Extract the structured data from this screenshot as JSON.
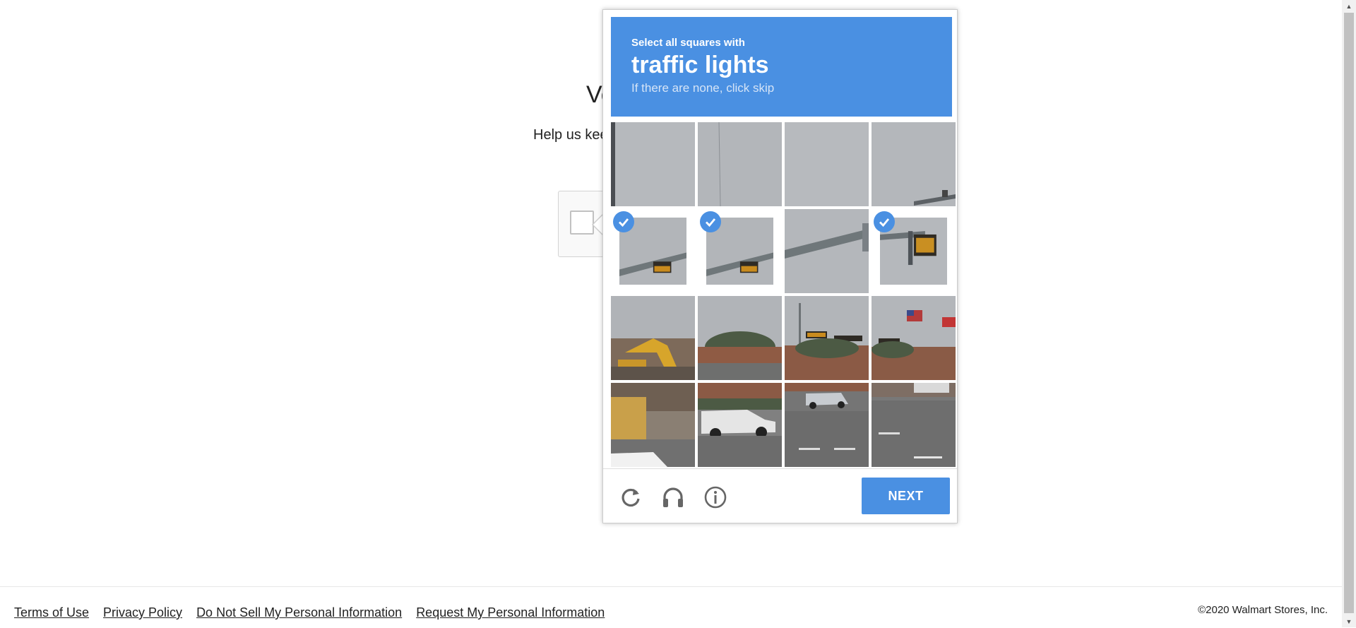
{
  "page": {
    "title_fragment": "Ve",
    "subtitle_fragment": "Help us kee"
  },
  "captcha": {
    "header_line1": "Select all squares with",
    "header_target": "traffic lights",
    "header_hint": "If there are none, click skip",
    "next_label": "NEXT",
    "accent_color": "#4a90e2",
    "tiles": [
      {
        "row": 0,
        "col": 0,
        "selected": false,
        "scene": "sky-pole-left"
      },
      {
        "row": 0,
        "col": 1,
        "selected": false,
        "scene": "sky-wire"
      },
      {
        "row": 0,
        "col": 2,
        "selected": false,
        "scene": "sky"
      },
      {
        "row": 0,
        "col": 3,
        "selected": false,
        "scene": "sky-arm"
      },
      {
        "row": 1,
        "col": 0,
        "selected": true,
        "scene": "arm-light"
      },
      {
        "row": 1,
        "col": 1,
        "selected": true,
        "scene": "arm-light"
      },
      {
        "row": 1,
        "col": 2,
        "selected": false,
        "scene": "arm"
      },
      {
        "row": 1,
        "col": 3,
        "selected": true,
        "scene": "light-box"
      },
      {
        "row": 2,
        "col": 0,
        "selected": false,
        "scene": "excavator"
      },
      {
        "row": 2,
        "col": 1,
        "selected": false,
        "scene": "trees-building"
      },
      {
        "row": 2,
        "col": 2,
        "selected": false,
        "scene": "lights-building"
      },
      {
        "row": 2,
        "col": 3,
        "selected": false,
        "scene": "flags-lights"
      },
      {
        "row": 3,
        "col": 0,
        "selected": false,
        "scene": "construction-car"
      },
      {
        "row": 3,
        "col": 1,
        "selected": false,
        "scene": "pickup-truck"
      },
      {
        "row": 3,
        "col": 2,
        "selected": false,
        "scene": "road-car"
      },
      {
        "row": 3,
        "col": 3,
        "selected": false,
        "scene": "road-crosswalk"
      }
    ],
    "controls": [
      {
        "name": "reload-icon"
      },
      {
        "name": "audio-challenge-icon"
      },
      {
        "name": "info-icon"
      }
    ]
  },
  "footer": {
    "links": [
      "Terms of Use",
      "Privacy Policy",
      "Do Not Sell My Personal Information",
      "Request My Personal Information"
    ],
    "copyright": "©2020 Walmart Stores, Inc."
  }
}
